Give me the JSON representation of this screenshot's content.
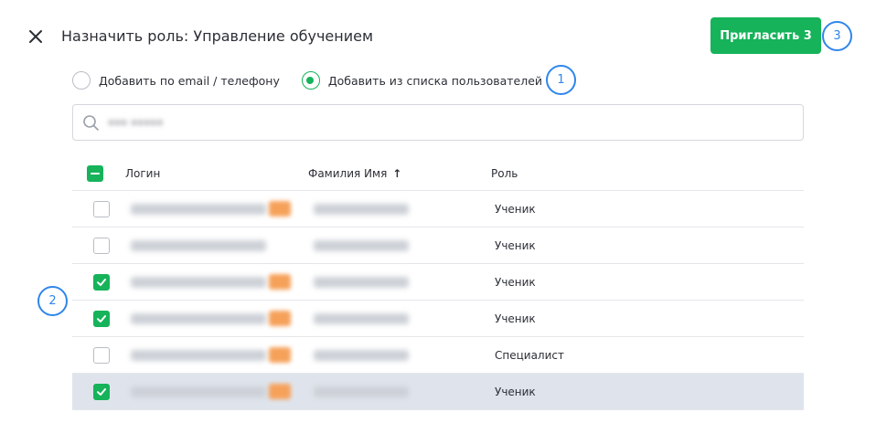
{
  "header": {
    "title": "Назначить роль: Управление обучением",
    "invite_label": "Пригласить 3"
  },
  "badges": [
    "1",
    "2",
    "3"
  ],
  "mode": {
    "options": [
      {
        "label": "Добавить по email / телефону",
        "checked": false
      },
      {
        "label": "Добавить из списка пользователей",
        "checked": true
      }
    ]
  },
  "search": {
    "value": "••• •••••"
  },
  "table": {
    "columns": {
      "login": "Логин",
      "name": "Фамилия Имя",
      "role": "Роль"
    },
    "sort_indicator": "↑",
    "rows": [
      {
        "role": "Ученик",
        "checked": false,
        "selected": false
      },
      {
        "role": "Ученик",
        "checked": false,
        "selected": false
      },
      {
        "role": "Ученик",
        "checked": true,
        "selected": false
      },
      {
        "role": "Ученик",
        "checked": true,
        "selected": false
      },
      {
        "role": "Специалист",
        "checked": false,
        "selected": false
      },
      {
        "role": "Ученик",
        "checked": true,
        "selected": true
      }
    ]
  },
  "colors": {
    "accent": "#16b35a",
    "badge": "#2f86eb",
    "selected_row": "#dfe4ec"
  },
  "icons": [
    "close-icon",
    "search-icon",
    "sort-up-arrow-icon",
    "checkmark-icon",
    "minus-icon"
  ]
}
